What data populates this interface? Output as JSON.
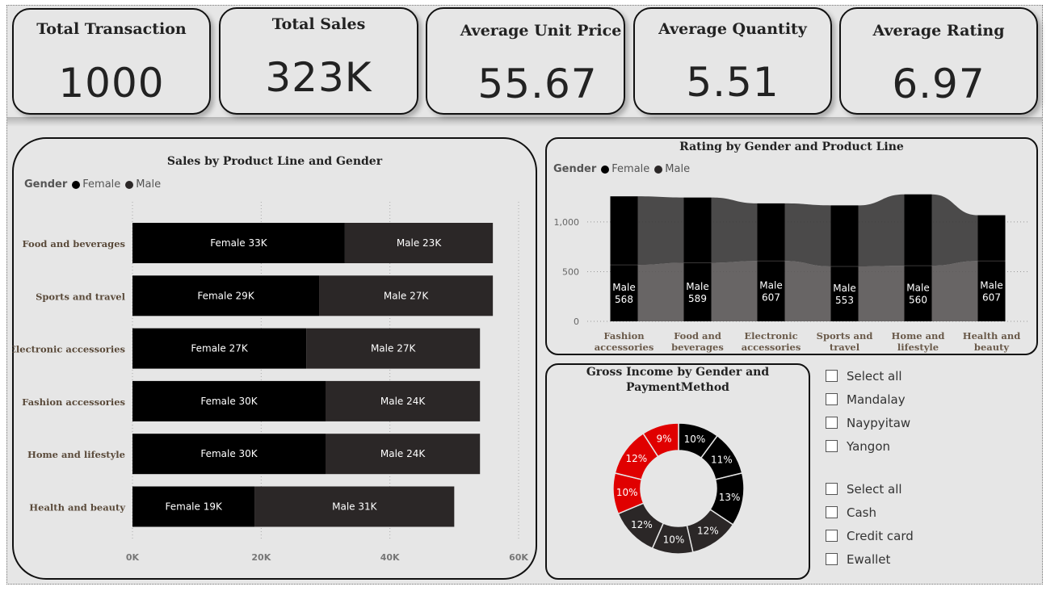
{
  "kpis": [
    {
      "title": "Total Transaction",
      "value": "1000"
    },
    {
      "title": "Total Sales",
      "value": "323K"
    },
    {
      "title": "Average Unit Price",
      "value": "55.67"
    },
    {
      "title": "Average Quantity",
      "value": "5.51"
    },
    {
      "title": "Average Rating",
      "value": "6.97"
    }
  ],
  "legend": {
    "title": "Gender",
    "female": "Female",
    "male": "Male"
  },
  "chart_data": [
    {
      "type": "bar",
      "orientation": "horizontal-stacked",
      "title": "Sales by Product Line and Gender",
      "categories": [
        "Food and beverages",
        "Sports and travel",
        "Electronic accessories",
        "Fashion accessories",
        "Home and lifestyle",
        "Health and beauty"
      ],
      "series": [
        {
          "name": "Female",
          "values": [
            33000,
            29000,
            27000,
            30000,
            30000,
            19000
          ],
          "labels": [
            "Female 33K",
            "Female 29K",
            "Female 27K",
            "Female 30K",
            "Female 30K",
            "Female 19K"
          ],
          "color": "#000000"
        },
        {
          "name": "Male",
          "values": [
            23000,
            27000,
            27000,
            24000,
            24000,
            31000
          ],
          "labels": [
            "Male 23K",
            "Male 27K",
            "Male 27K",
            "Male 24K",
            "Male 24K",
            "Male 31K"
          ],
          "color": "#2b2727"
        }
      ],
      "xlim": [
        0,
        60000
      ],
      "xticks": [
        "0K",
        "20K",
        "40K",
        "60K"
      ],
      "grid": true,
      "legend_position": "top-left"
    },
    {
      "type": "bar",
      "orientation": "vertical-stacked-ribbon",
      "title": "Rating by Gender and Product Line",
      "categories": [
        "Fashion accessories",
        "Food and beverages",
        "Electronic accessories",
        "Sports and travel",
        "Home and lifestyle",
        "Health and beauty"
      ],
      "category_lines": [
        [
          "Fashion",
          "accessories"
        ],
        [
          "Food and",
          "beverages"
        ],
        [
          "Electronic",
          "accessories"
        ],
        [
          "Sports and",
          "travel"
        ],
        [
          "Home and",
          "lifestyle"
        ],
        [
          "Health and",
          "beauty"
        ]
      ],
      "series": [
        {
          "name": "Male",
          "values": [
            568,
            589,
            607,
            553,
            560,
            607
          ],
          "labels": [
            "Male 568",
            "Male 589",
            "Male 607",
            "Male 553",
            "Male 560",
            "Male 607"
          ],
          "color": "#555555"
        },
        {
          "name": "Female",
          "values": [
            690,
            657,
            580,
            614,
            718,
            461
          ],
          "color": "#000000"
        }
      ],
      "ylim": [
        0,
        1300
      ],
      "yticks": [
        "0",
        "500",
        "1,000"
      ],
      "grid": true,
      "legend_position": "top-left"
    },
    {
      "type": "pie",
      "variant": "donut",
      "title": "Gross Income by Gender and PaymentMethod",
      "title_lines": [
        "Gross Income by Gender and",
        "PaymentMethod"
      ],
      "slices": [
        {
          "value": 10,
          "label": "10%",
          "color": "#000000"
        },
        {
          "value": 11,
          "label": "11%",
          "color": "#000000"
        },
        {
          "value": 13,
          "label": "13%",
          "color": "#000000"
        },
        {
          "value": 12,
          "label": "12%",
          "color": "#2b2727"
        },
        {
          "value": 10,
          "label": "10%",
          "color": "#2b2727"
        },
        {
          "value": 12,
          "label": "12%",
          "color": "#2b2727"
        },
        {
          "value": 10,
          "label": "10%",
          "color": "#e00000"
        },
        {
          "value": 12,
          "label": "12%",
          "color": "#e00000"
        },
        {
          "value": 9,
          "label": "9%",
          "color": "#e00000"
        }
      ]
    }
  ],
  "slicers": {
    "city": [
      "Select all",
      "Mandalay",
      "Naypyitaw",
      "Yangon"
    ],
    "payment": [
      "Select all",
      "Cash",
      "Credit card",
      "Ewallet"
    ]
  },
  "colors": {
    "female": "#000000",
    "male": "#2b2727",
    "accent": "#e00000",
    "background": "#e6e6e6"
  }
}
